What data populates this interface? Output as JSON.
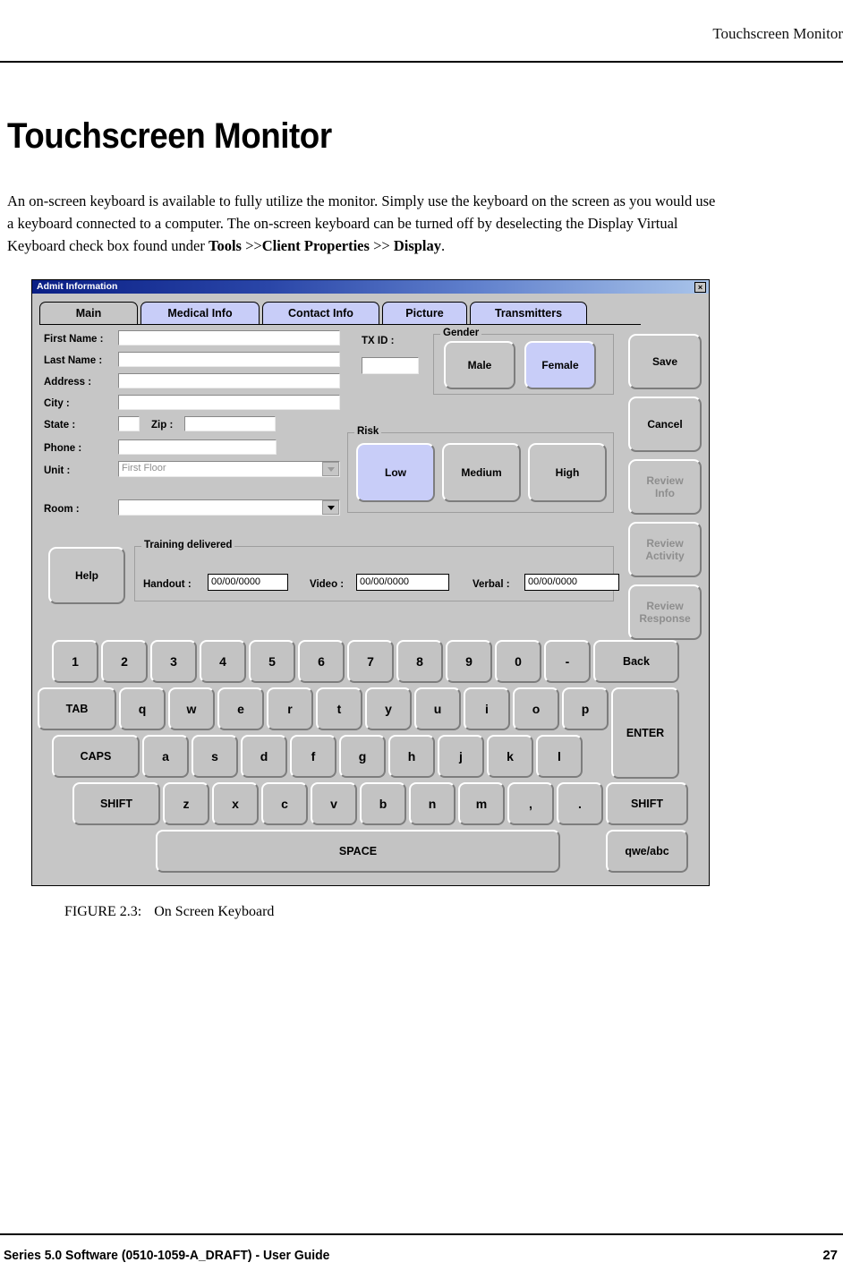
{
  "page": {
    "running_head": "Touchscreen Monitor",
    "title": "Touchscreen Monitor",
    "paragraph_part1": "An on-screen keyboard is available to fully utilize the monitor. Simply use the keyboard on the screen as you would use a keyboard connected to a computer. The on-screen keyboard can be turned off by deselecting the Display Virtual Keyboard check box found under ",
    "paragraph_bold1": "Tools",
    "paragraph_mid": " >>",
    "paragraph_bold2": "Client Properties",
    "paragraph_mid2": " >> ",
    "paragraph_bold3": "Display",
    "paragraph_end": ".",
    "figure_number": "FIGURE 2.3:",
    "figure_caption": "On Screen Keyboard",
    "footer_left": "Series 5.0 Software (0510-1059-A_DRAFT) - User Guide",
    "footer_page": "27"
  },
  "dialog": {
    "title": "Admit Information",
    "close_label": "×",
    "tabs": [
      {
        "label": "Main",
        "selected": true
      },
      {
        "label": "Medical Info",
        "selected": false
      },
      {
        "label": "Contact Info",
        "selected": false
      },
      {
        "label": "Picture",
        "selected": false
      },
      {
        "label": "Transmitters",
        "selected": false
      }
    ],
    "fields": {
      "first_name_label": "First Name :",
      "first_name_value": "",
      "last_name_label": "Last Name :",
      "last_name_value": "",
      "address_label": "Address :",
      "address_value": "",
      "city_label": "City :",
      "city_value": "",
      "state_label": "State :",
      "state_value": "",
      "zip_label": "Zip :",
      "zip_value": "",
      "phone_label": "Phone :",
      "phone_value": "",
      "unit_label": "Unit :",
      "unit_value": "First Floor",
      "room_label": "Room :",
      "room_value": "",
      "tx_id_label": "TX ID :",
      "tx_id_value": ""
    },
    "gender": {
      "group_label": "Gender",
      "options": [
        {
          "label": "Male",
          "selected": false
        },
        {
          "label": "Female",
          "selected": true
        }
      ]
    },
    "risk": {
      "group_label": "Risk",
      "options": [
        {
          "label": "Low",
          "selected": true
        },
        {
          "label": "Medium",
          "selected": false
        },
        {
          "label": "High",
          "selected": false
        }
      ]
    },
    "training": {
      "group_label": "Training delivered",
      "handout_label": "Handout :",
      "handout_value": "00/00/0000",
      "video_label": "Video :",
      "video_value": "00/00/0000",
      "verbal_label": "Verbal :",
      "verbal_value": "00/00/0000"
    },
    "help_button": "Help",
    "side_buttons": [
      {
        "label": "Save",
        "enabled": true
      },
      {
        "label": "Cancel",
        "enabled": true
      },
      {
        "label": "Review\nInfo",
        "enabled": false
      },
      {
        "label": "Review\nActivity",
        "enabled": false
      },
      {
        "label": "Review\nResponse",
        "enabled": false
      }
    ],
    "keyboard": {
      "row1": [
        "1",
        "2",
        "3",
        "4",
        "5",
        "6",
        "7",
        "8",
        "9",
        "0",
        "-"
      ],
      "back": "Back",
      "tab": "TAB",
      "row2": [
        "q",
        "w",
        "e",
        "r",
        "t",
        "y",
        "u",
        "i",
        "o",
        "p"
      ],
      "enter": "ENTER",
      "caps": "CAPS",
      "row3": [
        "a",
        "s",
        "d",
        "f",
        "g",
        "h",
        "j",
        "k",
        "l"
      ],
      "shift_left": "SHIFT",
      "row4": [
        "z",
        "x",
        "c",
        "v",
        "b",
        "n",
        "m",
        ",",
        "."
      ],
      "shift_right": "SHIFT",
      "space": "SPACE",
      "mode": "qwe/abc"
    }
  },
  "colors": {
    "accent_selected": "#c8cdf8",
    "dialog_face": "#c6c6c6",
    "titlebar_dark": "#0a1f85"
  }
}
